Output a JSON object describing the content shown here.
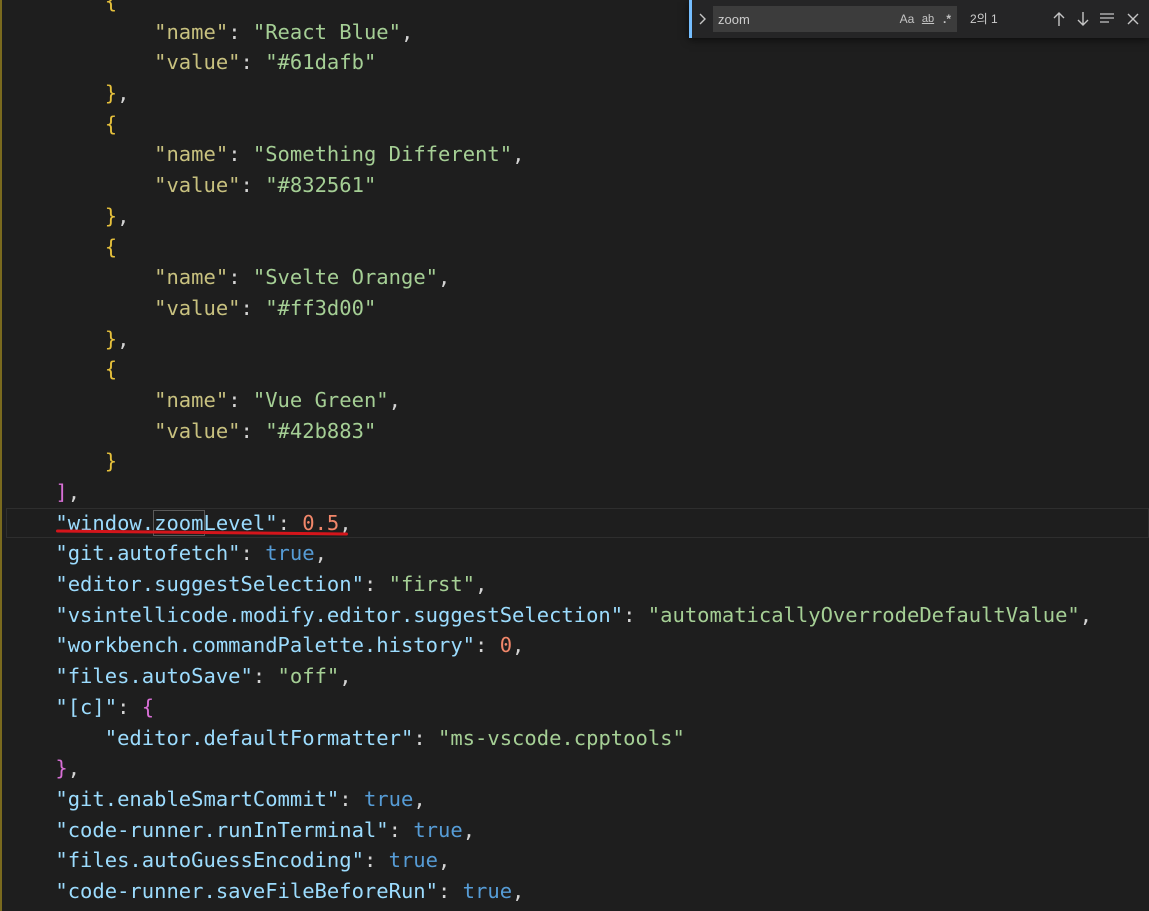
{
  "editor": {
    "lines": [
      [
        [
          "t-br3",
          "    {"
        ]
      ],
      [
        [
          "t-punc",
          "        "
        ],
        [
          "t-keyname",
          "\"name\""
        ],
        [
          "t-punc",
          ": "
        ],
        [
          "t-valname",
          "\"React Blue\""
        ],
        [
          "t-punc",
          ","
        ]
      ],
      [
        [
          "t-punc",
          "        "
        ],
        [
          "t-keyname",
          "\"value\""
        ],
        [
          "t-punc",
          ": "
        ],
        [
          "t-valname",
          "\"#61dafb\""
        ]
      ],
      [
        [
          "t-br3",
          "    }"
        ],
        [
          "t-punc",
          ","
        ]
      ],
      [
        [
          "t-br3",
          "    {"
        ]
      ],
      [
        [
          "t-punc",
          "        "
        ],
        [
          "t-keyname",
          "\"name\""
        ],
        [
          "t-punc",
          ": "
        ],
        [
          "t-valname",
          "\"Something Different\""
        ],
        [
          "t-punc",
          ","
        ]
      ],
      [
        [
          "t-punc",
          "        "
        ],
        [
          "t-keyname",
          "\"value\""
        ],
        [
          "t-punc",
          ": "
        ],
        [
          "t-valname",
          "\"#832561\""
        ]
      ],
      [
        [
          "t-br3",
          "    }"
        ],
        [
          "t-punc",
          ","
        ]
      ],
      [
        [
          "t-br3",
          "    {"
        ]
      ],
      [
        [
          "t-punc",
          "        "
        ],
        [
          "t-keyname",
          "\"name\""
        ],
        [
          "t-punc",
          ": "
        ],
        [
          "t-valname",
          "\"Svelte Orange\""
        ],
        [
          "t-punc",
          ","
        ]
      ],
      [
        [
          "t-punc",
          "        "
        ],
        [
          "t-keyname",
          "\"value\""
        ],
        [
          "t-punc",
          ": "
        ],
        [
          "t-valname",
          "\"#ff3d00\""
        ]
      ],
      [
        [
          "t-br3",
          "    }"
        ],
        [
          "t-punc",
          ","
        ]
      ],
      [
        [
          "t-br3",
          "    {"
        ]
      ],
      [
        [
          "t-punc",
          "        "
        ],
        [
          "t-keyname",
          "\"name\""
        ],
        [
          "t-punc",
          ": "
        ],
        [
          "t-valname",
          "\"Vue Green\""
        ],
        [
          "t-punc",
          ","
        ]
      ],
      [
        [
          "t-punc",
          "        "
        ],
        [
          "t-keyname",
          "\"value\""
        ],
        [
          "t-punc",
          ": "
        ],
        [
          "t-valname",
          "\"#42b883\""
        ]
      ],
      [
        [
          "t-br3",
          "    }"
        ]
      ],
      [
        [
          "t-br2",
          "]"
        ],
        [
          "t-punc",
          ","
        ]
      ],
      [
        [
          "t-key",
          "\"window."
        ],
        [
          "t-key match-box",
          "zoom"
        ],
        [
          "t-key",
          "Level\""
        ],
        [
          "t-punc",
          ": "
        ],
        [
          "t-num",
          "0.5"
        ],
        [
          "t-punc",
          ","
        ]
      ],
      [
        [
          "t-key",
          "\"git.autofetch\""
        ],
        [
          "t-punc",
          ": "
        ],
        [
          "t-kw",
          "true"
        ],
        [
          "t-punc",
          ","
        ]
      ],
      [
        [
          "t-key",
          "\"editor.suggestSelection\""
        ],
        [
          "t-punc",
          ": "
        ],
        [
          "t-str2",
          "\"first\""
        ],
        [
          "t-punc",
          ","
        ]
      ],
      [
        [
          "t-key",
          "\"vsintellicode.modify.editor.suggestSelection\""
        ],
        [
          "t-punc",
          ": "
        ],
        [
          "t-str2",
          "\"automaticallyOverrodeDefaultValue\""
        ],
        [
          "t-punc",
          ","
        ]
      ],
      [
        [
          "t-key",
          "\"workbench.commandPalette.history\""
        ],
        [
          "t-punc",
          ": "
        ],
        [
          "t-num",
          "0"
        ],
        [
          "t-punc",
          ","
        ]
      ],
      [
        [
          "t-key",
          "\"files.autoSave\""
        ],
        [
          "t-punc",
          ": "
        ],
        [
          "t-str2",
          "\"off\""
        ],
        [
          "t-punc",
          ","
        ]
      ],
      [
        [
          "t-key",
          "\"[c]\""
        ],
        [
          "t-punc",
          ": "
        ],
        [
          "t-br2",
          "{"
        ]
      ],
      [
        [
          "t-punc",
          "    "
        ],
        [
          "t-key",
          "\"editor.defaultFormatter\""
        ],
        [
          "t-punc",
          ": "
        ],
        [
          "t-str2",
          "\"ms-vscode.cpptools\""
        ]
      ],
      [
        [
          "t-br2",
          "}"
        ],
        [
          "t-punc",
          ","
        ]
      ],
      [
        [
          "t-key",
          "\"git.enableSmartCommit\""
        ],
        [
          "t-punc",
          ": "
        ],
        [
          "t-kw",
          "true"
        ],
        [
          "t-punc",
          ","
        ]
      ],
      [
        [
          "t-key",
          "\"code-runner.runInTerminal\""
        ],
        [
          "t-punc",
          ": "
        ],
        [
          "t-kw",
          "true"
        ],
        [
          "t-punc",
          ","
        ]
      ],
      [
        [
          "t-key",
          "\"files.autoGuessEncoding\""
        ],
        [
          "t-punc",
          ": "
        ],
        [
          "t-kw",
          "true"
        ],
        [
          "t-punc",
          ","
        ]
      ],
      [
        [
          "t-key",
          "\"code-runner.saveFileBeforeRun\""
        ],
        [
          "t-punc",
          ": "
        ],
        [
          "t-kw",
          "true"
        ],
        [
          "t-punc",
          ","
        ]
      ]
    ],
    "current_line_index": 17
  },
  "find": {
    "query": "zoom",
    "toggle_replace_icon": "chevron-right-icon",
    "match_case_label": "Aa",
    "whole_word_label": "ab",
    "regex_label": ".*",
    "result_count": "2의 1",
    "prev_icon": "arrow-up-icon",
    "next_icon": "arrow-down-icon",
    "selection_icon": "find-in-selection-icon",
    "close_icon": "close-icon"
  },
  "colors": {
    "background": "#1e1e1e",
    "key": "#9cdcfe",
    "string": "#a5cf95",
    "keyword": "#569cd6",
    "number": "#f2876a",
    "annotation_underline": "#d4151b",
    "find_accent": "#75beff"
  }
}
